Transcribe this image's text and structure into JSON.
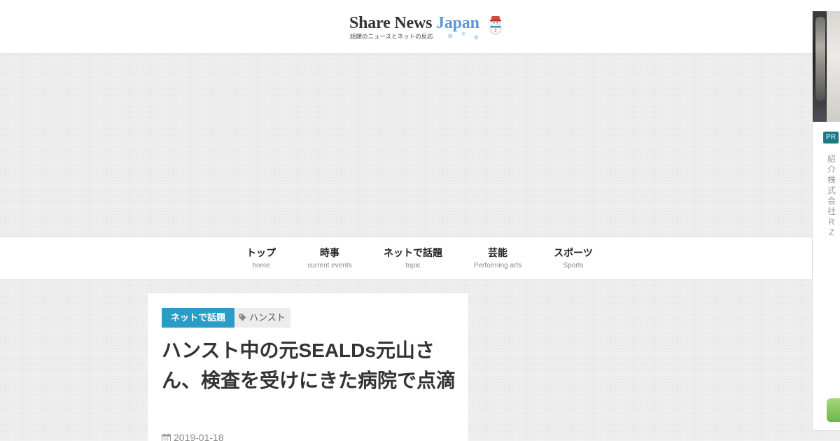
{
  "header": {
    "logo_main": "Share News ",
    "logo_accent": "Japan",
    "logo_tagline": "話題のニュースとネットの反応",
    "colors": {
      "accent": "#5a98d6"
    }
  },
  "nav": {
    "items": [
      {
        "label": "トップ",
        "sub": "home"
      },
      {
        "label": "時事",
        "sub": "current events"
      },
      {
        "label": "ネットで話題",
        "sub": "topic"
      },
      {
        "label": "芸能",
        "sub": "Performing arts"
      },
      {
        "label": "スポーツ",
        "sub": "Sports"
      }
    ]
  },
  "article": {
    "category": "ネットで話題",
    "tag": "ハンスト",
    "tag_icon": "tag-icon",
    "title": "ハンスト中の元SEALDs元山さん、検査を受けにきた病院で点滴",
    "date": "2019-01-18",
    "date_icon": "calendar-icon",
    "colors": {
      "category_bg": "#2a9cc8"
    }
  },
  "side_ad": {
    "badge": "PR",
    "text": "紹介株式会社RZ",
    "colors": {
      "badge_bg": "#1a7a86",
      "button": "#6cb548"
    }
  }
}
